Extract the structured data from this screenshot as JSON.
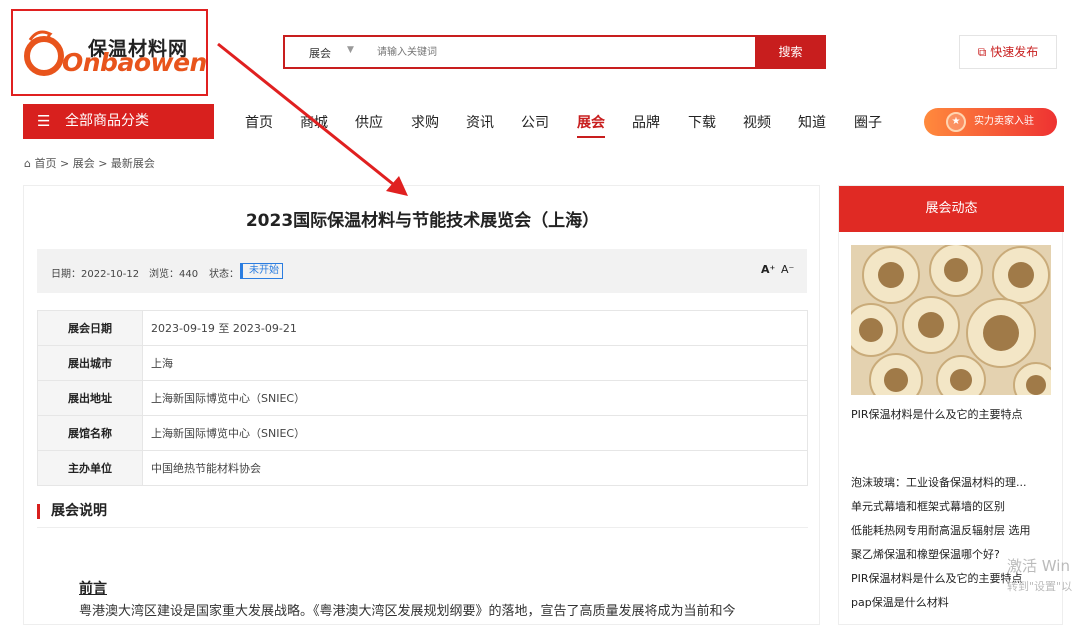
{
  "header": {
    "logo_cn": "保温材料网",
    "logo_en": "Onbaowen",
    "search": {
      "category": "展会",
      "placeholder": "请输入关键词",
      "button": "搜索"
    },
    "publish_button": "快速发布"
  },
  "nav": {
    "category_button": "全部商品分类",
    "items": [
      "首页",
      "商城",
      "供应",
      "求购",
      "资讯",
      "公司",
      "展会",
      "品牌",
      "下载",
      "视频",
      "知道",
      "圈子"
    ],
    "active": "展会",
    "vip_button": "实力卖家入驻"
  },
  "breadcrumb": "首页 > 展会 > 最新展会",
  "article": {
    "title": "2023国际保温材料与节能技术展览会（上海）",
    "date": "日期：2022-10-12",
    "views": "浏览：440",
    "status_label": "状态：",
    "status": "未开始",
    "font_up": "A⁺",
    "font_down": "A⁻",
    "info": [
      {
        "key": "展会日期",
        "value": "2023-09-19 至 2023-09-21"
      },
      {
        "key": "展出城市",
        "value": "上海"
      },
      {
        "key": "展出地址",
        "value": "上海新国际博览中心（SNIEC）"
      },
      {
        "key": "展馆名称",
        "value": "上海新国际博览中心（SNIEC）"
      },
      {
        "key": "主办单位",
        "value": "中国绝热节能材料协会"
      }
    ],
    "section_title": "展会说明",
    "preface": "前言",
    "para1": "粤港澳大湾区建设是国家重大发展战略。《粤港澳大湾区发展规划纲要》的落地，宣告了高质量发展将成为当前和今",
    "para2": ""
  },
  "sidebar": {
    "heading": "展会动态",
    "image_caption": "PIR保温材料是什么及它的主要特点",
    "links": [
      "泡沫玻璃：工业设备保温材料的理...",
      "单元式幕墙和框架式幕墙的区别",
      "低能耗热网专用耐高温反辐射层 选用",
      "聚乙烯保温和橡塑保温哪个好?",
      "PIR保温材料是什么及它的主要特点",
      "pap保温是什么材料"
    ]
  },
  "overlay": {
    "watermark_line1": "激活 Win",
    "watermark_line2": "转到\"设置\"以"
  }
}
